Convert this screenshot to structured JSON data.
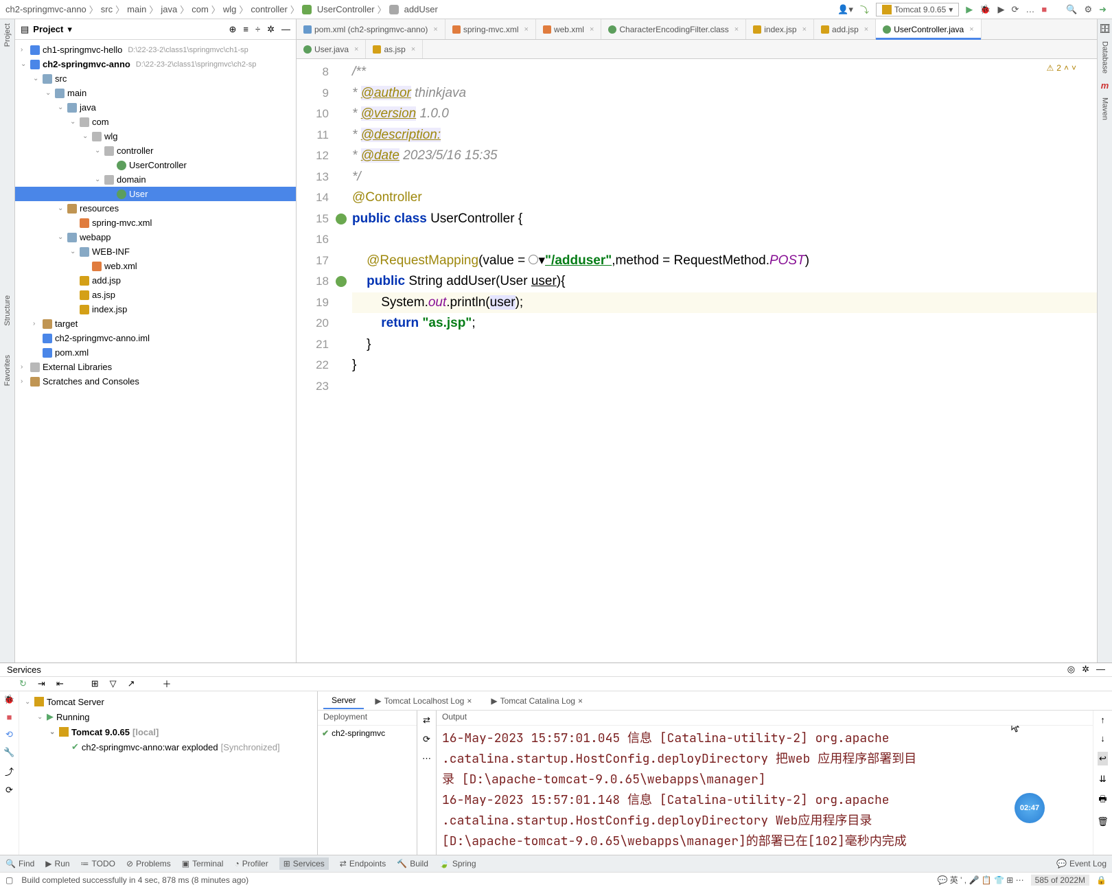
{
  "breadcrumb": [
    "ch2-springmvc-anno",
    "src",
    "main",
    "java",
    "com",
    "wlg",
    "controller",
    "UserController",
    "addUser"
  ],
  "breadcrumb_icons": {
    "UserController": "class",
    "addUser": "method"
  },
  "run_config": "Tomcat 9.0.65",
  "project": {
    "title": "Project",
    "tree": [
      {
        "lvl": 0,
        "arr": ">",
        "ico": "mod",
        "label": "ch1-springmvc-hello",
        "dim": "D:\\22-23-2\\class1\\springmvc\\ch1-sp"
      },
      {
        "lvl": 0,
        "arr": "v",
        "ico": "mod",
        "label": "ch2-springmvc-anno",
        "dim": "D:\\22-23-2\\class1\\springmvc\\ch2-sp",
        "bold": true
      },
      {
        "lvl": 1,
        "arr": "v",
        "ico": "fold",
        "label": "src"
      },
      {
        "lvl": 2,
        "arr": "v",
        "ico": "fold",
        "label": "main"
      },
      {
        "lvl": 3,
        "arr": "v",
        "ico": "fold",
        "label": "java"
      },
      {
        "lvl": 4,
        "arr": "v",
        "ico": "pkg",
        "label": "com"
      },
      {
        "lvl": 5,
        "arr": "v",
        "ico": "pkg",
        "label": "wlg"
      },
      {
        "lvl": 6,
        "arr": "v",
        "ico": "pkg",
        "label": "controller"
      },
      {
        "lvl": 7,
        "arr": "",
        "ico": "cls",
        "label": "UserController"
      },
      {
        "lvl": 6,
        "arr": "v",
        "ico": "pkg",
        "label": "domain"
      },
      {
        "lvl": 7,
        "arr": "",
        "ico": "cls",
        "label": "User",
        "sel": true
      },
      {
        "lvl": 3,
        "arr": "v",
        "ico": "res",
        "label": "resources"
      },
      {
        "lvl": 4,
        "arr": "",
        "ico": "xml",
        "label": "spring-mvc.xml"
      },
      {
        "lvl": 3,
        "arr": "v",
        "ico": "fold",
        "label": "webapp"
      },
      {
        "lvl": 4,
        "arr": "v",
        "ico": "fold",
        "label": "WEB-INF"
      },
      {
        "lvl": 5,
        "arr": "",
        "ico": "xml",
        "label": "web.xml"
      },
      {
        "lvl": 4,
        "arr": "",
        "ico": "jsp",
        "label": "add.jsp"
      },
      {
        "lvl": 4,
        "arr": "",
        "ico": "jsp",
        "label": "as.jsp"
      },
      {
        "lvl": 4,
        "arr": "",
        "ico": "jsp",
        "label": "index.jsp"
      },
      {
        "lvl": 1,
        "arr": ">",
        "ico": "res",
        "label": "target"
      },
      {
        "lvl": 1,
        "arr": "",
        "ico": "mod",
        "label": "ch2-springmvc-anno.iml"
      },
      {
        "lvl": 1,
        "arr": "",
        "ico": "m",
        "label": "pom.xml"
      },
      {
        "lvl": 0,
        "arr": ">",
        "ico": "lib",
        "label": "External Libraries"
      },
      {
        "lvl": 0,
        "arr": ">",
        "ico": "scr",
        "label": "Scratches and Consoles"
      }
    ]
  },
  "tabs_row1": [
    {
      "ico": "m",
      "label": "pom.xml (ch2-springmvc-anno)"
    },
    {
      "ico": "xml",
      "label": "spring-mvc.xml"
    },
    {
      "ico": "xml",
      "label": "web.xml"
    },
    {
      "ico": "cls",
      "label": "CharacterEncodingFilter.class"
    },
    {
      "ico": "jsp",
      "label": "index.jsp"
    },
    {
      "ico": "jsp",
      "label": "add.jsp"
    },
    {
      "ico": "cls",
      "label": "UserController.java",
      "active": true
    }
  ],
  "tabs_row2": [
    {
      "ico": "cls",
      "label": "User.java"
    },
    {
      "ico": "jsp",
      "label": "as.jsp"
    }
  ],
  "warn_count": "2",
  "code_lines": {
    "start": 8,
    "l8": "/**",
    "l9_pre": " * ",
    "l9_tag": "@author",
    "l9_rest": " thinkjava",
    "l10_pre": " * ",
    "l10_tag": "@version",
    "l10_rest": " 1.0.0",
    "l11_pre": " * ",
    "l11_tag": "@description:",
    "l12_pre": " * ",
    "l12_tag": "@date",
    "l12_rest": " 2023/5/16 15:35",
    "l13": " */",
    "l14": "@Controller",
    "l15_a": "public",
    "l15_b": "class",
    "l15_c": "UserController {",
    "l17_a": "@RequestMapping",
    "l17_b": "(value = ",
    "l17_url": "\"/adduser\"",
    "l17_c": ",method = RequestMethod.",
    "l17_d": "POST",
    "l17_e": ")",
    "l18_a": "public",
    "l18_b": "String addUser(User ",
    "l18_c": "user",
    "l18_d": "){",
    "l19_a": "System.",
    "l19_b": "out",
    "l19_c": ".println(",
    "l19_d": "user",
    "l19_e": ");",
    "l20_a": "return",
    "l20_b": "\"as.jsp\"",
    "l20_c": ";",
    "l21": "}",
    "l22": "}"
  },
  "services": {
    "title": "Services",
    "servertabs": [
      "Server",
      "Tomcat Localhost Log",
      "Tomcat Catalina Log"
    ],
    "tree": [
      {
        "lvl": 0,
        "arr": "v",
        "ico": "tomcat",
        "label": "Tomcat Server"
      },
      {
        "lvl": 1,
        "arr": "v",
        "ico": "run",
        "label": "Running"
      },
      {
        "lvl": 2,
        "arr": "v",
        "ico": "tomcat",
        "label": "Tomcat 9.0.65",
        "dim": "[local]",
        "bold": true
      },
      {
        "lvl": 3,
        "arr": "",
        "ico": "ok",
        "label": "ch2-springmvc-anno:war exploded",
        "dim": "[Synchronized]"
      }
    ],
    "dep_header": "Deployment",
    "out_header": "Output",
    "dep_item": "ch2-springmvc",
    "output": "16-May-2023 15:57:01.045 信息 [Catalina-utility-2] org.apache.catalina.startup.HostConfig.deployDirectory 把web 应用程序部署到目录 [D:\\apache-tomcat-9.0.65\\webapps\\manager]\n16-May-2023 15:57:01.148 信息 [Catalina-utility-2] org.apache.catalina.startup.HostConfig.deployDirectory Web应用程序目录[D:\\apache-tomcat-9.0.65\\webapps\\manager]的部署已在[102]毫秒内完成"
  },
  "timer": "02:47",
  "bottom": {
    "find": "Find",
    "run": "Run",
    "todo": "TODO",
    "problems": "Problems",
    "terminal": "Terminal",
    "profiler": "Profiler",
    "services": "Services",
    "endpoints": "Endpoints",
    "build": "Build",
    "spring": "Spring",
    "eventlog": "Event Log"
  },
  "status": {
    "msg": "Build completed successfully in 4 sec, 878 ms (8 minutes ago)",
    "ime": "英",
    "mem": "585 of 2022M"
  },
  "sidebars": {
    "project": "Project",
    "structure": "Structure",
    "favorites": "Favorites",
    "database": "Database",
    "maven": "Maven"
  }
}
